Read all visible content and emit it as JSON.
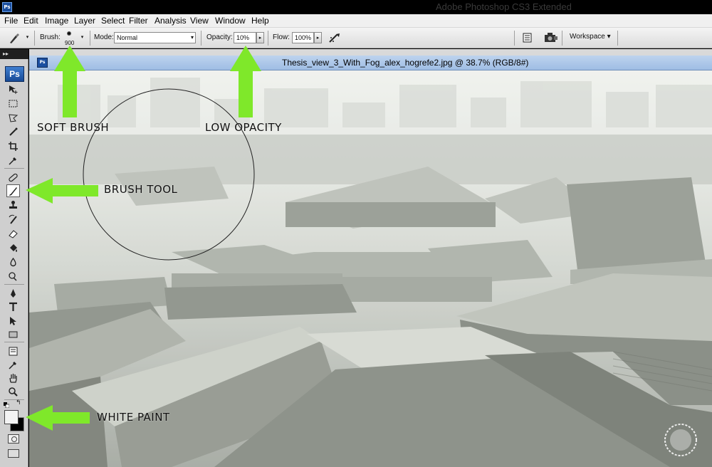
{
  "app": {
    "title": "Adobe Photoshop CS3 Extended",
    "logo_text": "Ps"
  },
  "menu": [
    "File",
    "Edit",
    "Image",
    "Layer",
    "Select",
    "Filter",
    "Analysis",
    "View",
    "Window",
    "Help"
  ],
  "options_bar": {
    "brush_label": "Brush:",
    "brush_size": "900",
    "mode_label": "Mode:",
    "mode_value": "Normal",
    "opacity_label": "Opacity:",
    "opacity_value": "10%",
    "flow_label": "Flow:",
    "flow_value": "100%",
    "workspace_label": "Workspace"
  },
  "toolbar": {
    "logo_text": "Ps",
    "grip": "▸▸",
    "tools": [
      "move-tool",
      "marquee-tool",
      "lasso-tool",
      "quick-selection-tool",
      "crop-tool",
      "eyedropper-tool",
      "healing-brush-tool",
      "brush-tool",
      "clone-stamp-tool",
      "history-brush-tool",
      "eraser-tool",
      "paint-bucket-tool",
      "blur-tool",
      "dodge-tool",
      "pen-tool",
      "type-tool",
      "path-selection-tool",
      "rectangle-tool",
      "notes-tool",
      "eyedropper-tool-2",
      "hand-tool",
      "zoom-tool"
    ],
    "active_tool": "brush-tool",
    "foreground_color": "#f3f3f3",
    "background_color": "#000000"
  },
  "document": {
    "icon_text": "Ps",
    "title": "Thesis_view_3_With_Fog_alex_hogrefe2.jpg @ 38.7% (RGB/8#)"
  },
  "annotations": {
    "soft_brush": "SOFT BRUSH",
    "low_opacity": "LOW OPACITY",
    "brush_tool": "BRUSH TOOL",
    "white_paint": "WHITE PAINT",
    "arrow_color": "#7fe82a"
  }
}
